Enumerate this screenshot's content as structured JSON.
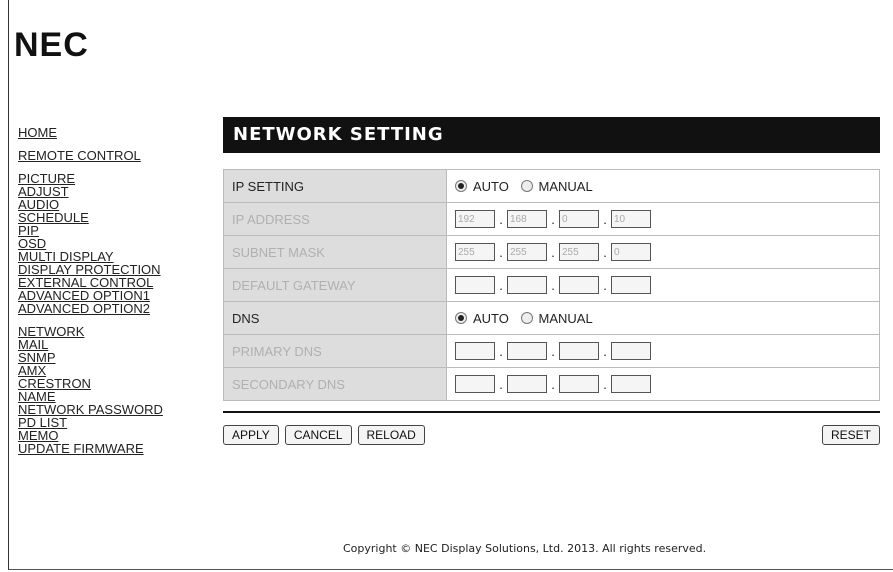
{
  "brand": {
    "logo": "NEC"
  },
  "nav": [
    [
      {
        "label": "HOME"
      }
    ],
    [
      {
        "label": "REMOTE CONTROL"
      }
    ],
    [
      {
        "label": "PICTURE"
      },
      {
        "label": "ADJUST"
      },
      {
        "label": "AUDIO"
      },
      {
        "label": "SCHEDULE"
      },
      {
        "label": "PIP"
      },
      {
        "label": "OSD"
      },
      {
        "label": "MULTI DISPLAY"
      },
      {
        "label": "DISPLAY PROTECTION"
      },
      {
        "label": "EXTERNAL CONTROL"
      },
      {
        "label": "ADVANCED OPTION1"
      },
      {
        "label": "ADVANCED OPTION2"
      }
    ],
    [
      {
        "label": "NETWORK"
      },
      {
        "label": "MAIL"
      },
      {
        "label": "SNMP"
      },
      {
        "label": "AMX"
      },
      {
        "label": "CRESTRON"
      },
      {
        "label": "NAME"
      },
      {
        "label": "NETWORK PASSWORD"
      },
      {
        "label": "PD LIST"
      },
      {
        "label": "MEMO"
      },
      {
        "label": "UPDATE FIRMWARE"
      }
    ]
  ],
  "page": {
    "title": "NETWORK SETTING"
  },
  "settings": {
    "ip_setting": {
      "label": "IP SETTING",
      "auto": "AUTO",
      "manual": "MANUAL",
      "selected": "AUTO"
    },
    "ip_address": {
      "label": "IP ADDRESS",
      "octets": [
        "192",
        "168",
        "0",
        "10"
      ]
    },
    "subnet_mask": {
      "label": "SUBNET MASK",
      "octets": [
        "255",
        "255",
        "255",
        "0"
      ]
    },
    "default_gateway": {
      "label": "DEFAULT GATEWAY",
      "octets": [
        "",
        "",
        "",
        ""
      ]
    },
    "dns": {
      "label": "DNS",
      "auto": "AUTO",
      "manual": "MANUAL",
      "selected": "AUTO"
    },
    "primary_dns": {
      "label": "PRIMARY DNS",
      "octets": [
        "",
        "",
        "",
        ""
      ]
    },
    "secondary_dns": {
      "label": "SECONDARY DNS",
      "octets": [
        "",
        "",
        "",
        ""
      ]
    }
  },
  "buttons": {
    "apply": "APPLY",
    "cancel": "CANCEL",
    "reload": "RELOAD",
    "reset": "RESET"
  },
  "footer": {
    "copyright": "Copyright © NEC Display Solutions, Ltd. 2013. All rights reserved."
  }
}
